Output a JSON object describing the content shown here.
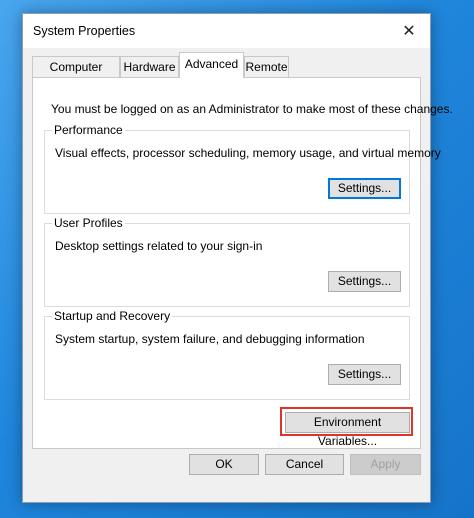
{
  "window": {
    "title": "System Properties",
    "close_glyph": "✕"
  },
  "tabs": [
    {
      "label": "Computer Name",
      "active": false
    },
    {
      "label": "Hardware",
      "active": false
    },
    {
      "label": "Advanced",
      "active": true
    },
    {
      "label": "Remote",
      "active": false
    }
  ],
  "advanced": {
    "notice": "You must be logged on as an Administrator to make most of these changes.",
    "performance": {
      "legend": "Performance",
      "description": "Visual effects, processor scheduling, memory usage, and virtual memory",
      "button": "Settings..."
    },
    "user_profiles": {
      "legend": "User Profiles",
      "description": "Desktop settings related to your sign-in",
      "button": "Settings..."
    },
    "startup_recovery": {
      "legend": "Startup and Recovery",
      "description": "System startup, system failure, and debugging information",
      "button": "Settings..."
    },
    "env_button": "Environment Variables..."
  },
  "footer": {
    "ok": "OK",
    "cancel": "Cancel",
    "apply": "Apply"
  },
  "colors": {
    "highlight": "#e0342b",
    "focus_border": "#0078d7",
    "desktop": "#1f86dc"
  }
}
